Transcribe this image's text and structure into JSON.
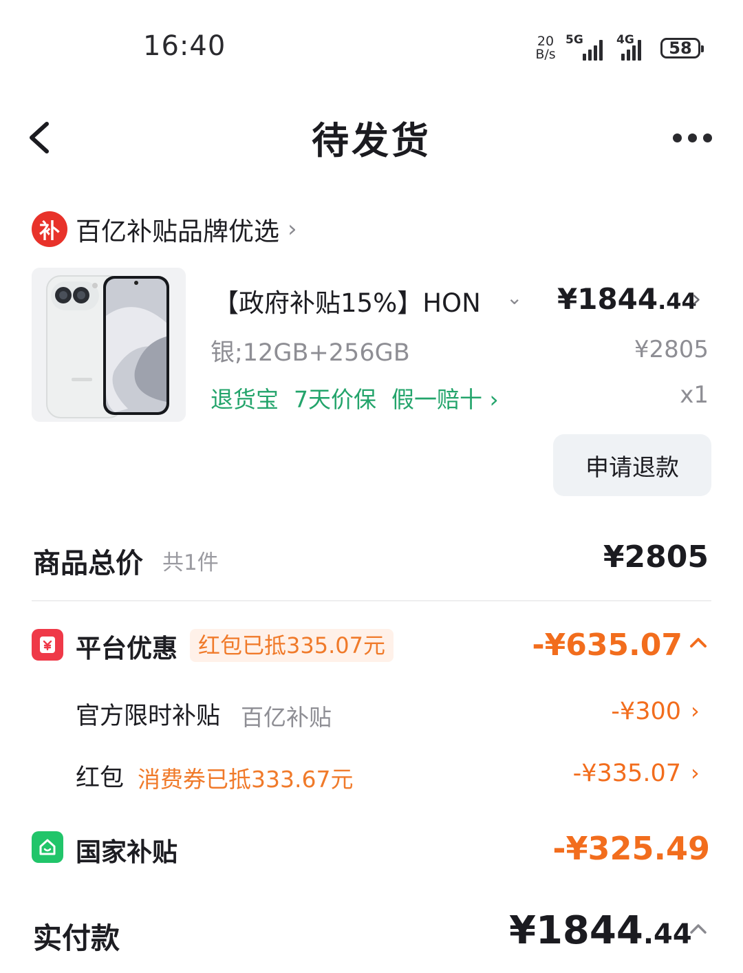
{
  "status_bar": {
    "time": "16:40",
    "net_speed_value": "20",
    "net_speed_unit": "B/s",
    "signal1_label": "5G",
    "signal2_label": "4G",
    "battery": "58"
  },
  "nav": {
    "title": "待发货",
    "back_icon": "chevron-left-icon",
    "more_icon": "more-horizontal-icon"
  },
  "shop": {
    "logo_text": "补",
    "name": "百亿补贴品牌优选",
    "chevron": "›"
  },
  "product": {
    "title": "【政府补贴15%】HON",
    "title_chevron": "⌄",
    "price_int": "¥1844",
    "price_dec": ".44",
    "price_chevron": "›",
    "spec": "银;12GB+256GB",
    "original_price": "¥2805",
    "tags": [
      "退货宝",
      "7天价保",
      "假一赔十 ›"
    ],
    "quantity": "x1",
    "refund_button": "申请退款"
  },
  "summary": {
    "total_label": "商品总价",
    "total_count": "共1件",
    "total_value": "¥2805",
    "platform": {
      "label": "平台优惠",
      "badge": "红包已抵335.07元",
      "value": "-¥635.07",
      "toggle": "^"
    },
    "official_subsidy": {
      "label": "官方限时补贴",
      "note": "百亿补贴",
      "value": "-¥300",
      "chevron": "›"
    },
    "red_packet": {
      "label": "红包",
      "note": "消费券已抵333.67元",
      "value": "-¥335.07",
      "chevron": "›"
    },
    "national": {
      "label": "国家补贴",
      "value": "-¥325.49"
    },
    "paid": {
      "label": "实付款",
      "value_int": "¥1844",
      "value_dec": ".44",
      "toggle": "^"
    }
  },
  "colors": {
    "accent_orange": "#f26d1d",
    "tag_green": "#23a46b",
    "brand_red": "#e8322a",
    "national_green": "#21c56a"
  }
}
